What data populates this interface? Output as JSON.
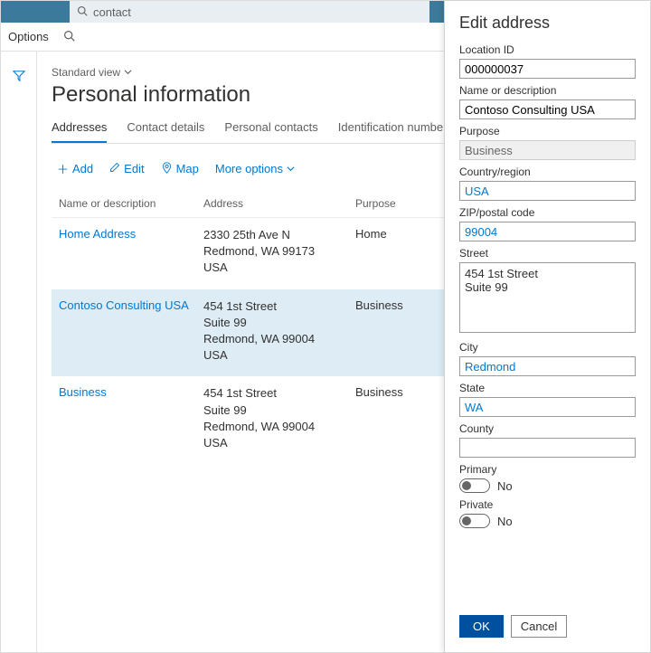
{
  "topbar": {
    "search_value": "contact"
  },
  "subbar": {
    "options_label": "Options"
  },
  "view": {
    "standard_view": "Standard view"
  },
  "page": {
    "title": "Personal information"
  },
  "tabs": {
    "addresses": "Addresses",
    "contact_details": "Contact details",
    "personal_contacts": "Personal contacts",
    "identification": "Identification numbers"
  },
  "toolbar": {
    "add": "Add",
    "edit": "Edit",
    "map": "Map",
    "more": "More options"
  },
  "grid": {
    "head": {
      "name": "Name or description",
      "address": "Address",
      "purpose": "Purpose"
    },
    "rows": [
      {
        "name": "Home Address",
        "address_lines": [
          "2330 25th Ave N",
          "Redmond, WA 99173",
          "USA"
        ],
        "purpose": "Home",
        "selected": false
      },
      {
        "name": "Contoso Consulting USA",
        "address_lines": [
          "454 1st Street",
          "Suite 99",
          "Redmond, WA 99004",
          "USA"
        ],
        "purpose": "Business",
        "selected": true
      },
      {
        "name": "Business",
        "address_lines": [
          "454 1st Street",
          "Suite 99",
          "Redmond, WA 99004",
          "USA"
        ],
        "purpose": "Business",
        "selected": false
      }
    ]
  },
  "panel": {
    "title": "Edit address",
    "labels": {
      "location_id": "Location ID",
      "name": "Name or description",
      "purpose": "Purpose",
      "country": "Country/region",
      "zip": "ZIP/postal code",
      "street": "Street",
      "city": "City",
      "state": "State",
      "county": "County",
      "primary": "Primary",
      "private": "Private"
    },
    "values": {
      "location_id": "000000037",
      "name": "Contoso Consulting USA",
      "purpose": "Business",
      "country": "USA",
      "zip": "99004",
      "street": "454 1st Street\nSuite 99",
      "city": "Redmond",
      "state": "WA",
      "county": "",
      "primary": "No",
      "private": "No"
    },
    "buttons": {
      "ok": "OK",
      "cancel": "Cancel"
    }
  }
}
